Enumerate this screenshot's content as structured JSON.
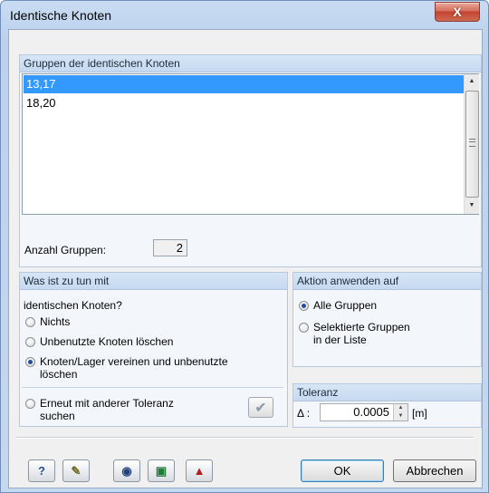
{
  "window": {
    "title": "Identische Knoten",
    "close_glyph": "X"
  },
  "groups_panel": {
    "header": "Gruppen der identischen Knoten",
    "items": [
      {
        "label": "13,17",
        "selected": true
      },
      {
        "label": "18,20",
        "selected": false
      }
    ],
    "count_label": "Anzahl Gruppen:",
    "count_value": "2"
  },
  "action_panel": {
    "header": "Was ist zu tun mit",
    "question": "identischen Knoten?",
    "options": [
      {
        "label": "Nichts",
        "checked": false
      },
      {
        "label": "Unbenutzte Knoten löschen",
        "checked": false
      },
      {
        "label_line1": "Knoten/Lager vereinen und unbenutzte",
        "label_line2": "löschen",
        "checked": true
      }
    ],
    "retry_option": {
      "label_line1": "Erneut mit anderer Toleranz",
      "label_line2": "suchen",
      "checked": false
    },
    "retry_button_icon": "checkmark-icon"
  },
  "apply_panel": {
    "header": "Aktion anwenden auf",
    "options": [
      {
        "label": "Alle Gruppen",
        "checked": true
      },
      {
        "label_line1": "Selektierte Gruppen",
        "label_line2": "in der Liste",
        "checked": false
      }
    ]
  },
  "tolerance_panel": {
    "header": "Toleranz",
    "delta_label": "Δ :",
    "value": "0.0005",
    "unit": "[m]"
  },
  "toolbar": {
    "icons": [
      "help-icon",
      "edit-icon",
      "view-icon",
      "excel-export-icon",
      "settings-icon"
    ]
  },
  "buttons": {
    "ok": "OK",
    "cancel": "Abbrechen"
  },
  "colors": {
    "selection": "#3399ff",
    "panel_header": "#c6d9f0",
    "window_frame": "#bcd2ee"
  }
}
